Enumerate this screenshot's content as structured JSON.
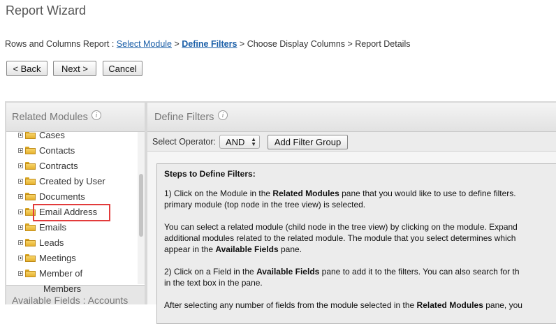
{
  "page": {
    "title": "Report Wizard"
  },
  "breadcrumb": {
    "prefix": "Rows and Columns Report : ",
    "step1": "Select Module",
    "sep1": " > ",
    "step2": "Define Filters",
    "rest": " > Choose Display Columns > Report Details"
  },
  "buttons": {
    "back": "< Back",
    "next": "Next >",
    "cancel": "Cancel"
  },
  "related_modules": {
    "title": "Related Modules",
    "items": [
      {
        "label": "Cases"
      },
      {
        "label": "Contacts"
      },
      {
        "label": "Contracts"
      },
      {
        "label": "Created by User"
      },
      {
        "label": "Documents"
      },
      {
        "label": "Email Address",
        "highlighted": true
      },
      {
        "label": "Emails"
      },
      {
        "label": "Leads"
      },
      {
        "label": "Meetings"
      },
      {
        "label": "Member of"
      }
    ],
    "trailing_item": "Members"
  },
  "available_fields": {
    "title": "Available Fields : Accounts"
  },
  "define_filters": {
    "title": "Define Filters",
    "operator_label": "Select Operator:",
    "operator_value": "AND",
    "add_group_label": "Add Filter Group",
    "steps": {
      "heading": "Steps to Define Filters:",
      "p1a": "1) Click on the Module in the ",
      "p1b": "Related Modules",
      "p1c": " pane that you would like to use to define filters.",
      "p1d": "primary module (top node in the tree view) is selected.",
      "p2a": "You can select a related module (child node in the tree view) by clicking on the module. Expand",
      "p2b": "additional modules related to the related module. The module that you select determines which",
      "p2c": "appear in the ",
      "p2d": "Available Fields",
      "p2e": " pane.",
      "p3a": "2) Click on a Field in the ",
      "p3b": "Available Fields",
      "p3c": " pane to add it to the filters. You can also search for th",
      "p3d": "in the text box in the pane.",
      "p4a": "After selecting any number of fields from the module selected in the ",
      "p4b": "Related Modules",
      "p4c": " pane, you"
    }
  }
}
